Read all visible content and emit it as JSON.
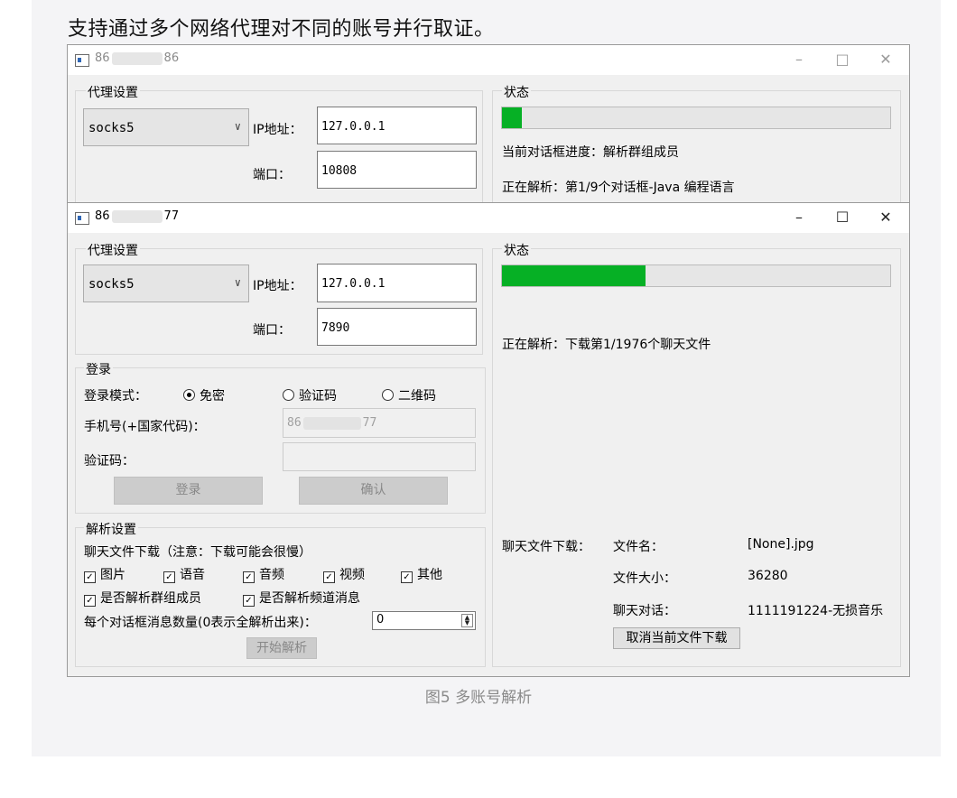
{
  "heading": "支持通过多个网络代理对不同的账号并行取证。",
  "caption": "图5 多账号解析",
  "window_back": {
    "title_prefix": "86",
    "title_suffix": "86",
    "controls": {
      "minimize": "–",
      "maximize": "□",
      "close": "✕"
    },
    "proxy": {
      "group_label": "代理设置",
      "protocol": "socks5",
      "ip_label": "IP地址：",
      "ip_value": "127.0.0.1",
      "port_label": "端口：",
      "port_value": "10808"
    },
    "status": {
      "group_label": "状态",
      "progress": 0.05,
      "line1": "当前对话框进度：解析群组成员",
      "line2": "正在解析：第1/9个对话框-Java 编程语言"
    }
  },
  "window_front": {
    "title_prefix": "86",
    "title_suffix": "77",
    "controls": {
      "minimize": "–",
      "maximize": "☐",
      "close": "✕"
    },
    "proxy": {
      "group_label": "代理设置",
      "protocol": "socks5",
      "ip_label": "IP地址：",
      "ip_value": "127.0.0.1",
      "port_label": "端口：",
      "port_value": "7890"
    },
    "login": {
      "group_label": "登录",
      "mode_label": "登录模式：",
      "modes": [
        "免密",
        "验证码",
        "二维码"
      ],
      "selected_mode": "免密",
      "phone_label": "手机号(+国家代码)：",
      "phone_prefix": "86",
      "phone_suffix": "77",
      "code_label": "验证码：",
      "login_button": "登录",
      "confirm_button": "确认"
    },
    "parse": {
      "group_label": "解析设置",
      "download_note": "聊天文件下载（注意：下载可能会很慢）",
      "media_checks": [
        "图片",
        "语音",
        "音频",
        "视频",
        "其他"
      ],
      "option_checks": [
        "是否解析群组成员",
        "是否解析频道消息"
      ],
      "count_label": "每个对话框消息数量(0表示全解析出来)：",
      "count_value": "0",
      "start_button": "开始解析"
    },
    "status": {
      "group_label": "状态",
      "progress": 0.37,
      "line1": "正在解析：下载第1/1976个聊天文件",
      "download_label": "聊天文件下载：",
      "file_name_label": "文件名：",
      "file_name_value": "[None].jpg",
      "file_size_label": "文件大小：",
      "file_size_value": "36280",
      "chat_label": "聊天对话：",
      "chat_value": "1111191224-无损音乐",
      "cancel_button": "取消当前文件下载"
    }
  }
}
